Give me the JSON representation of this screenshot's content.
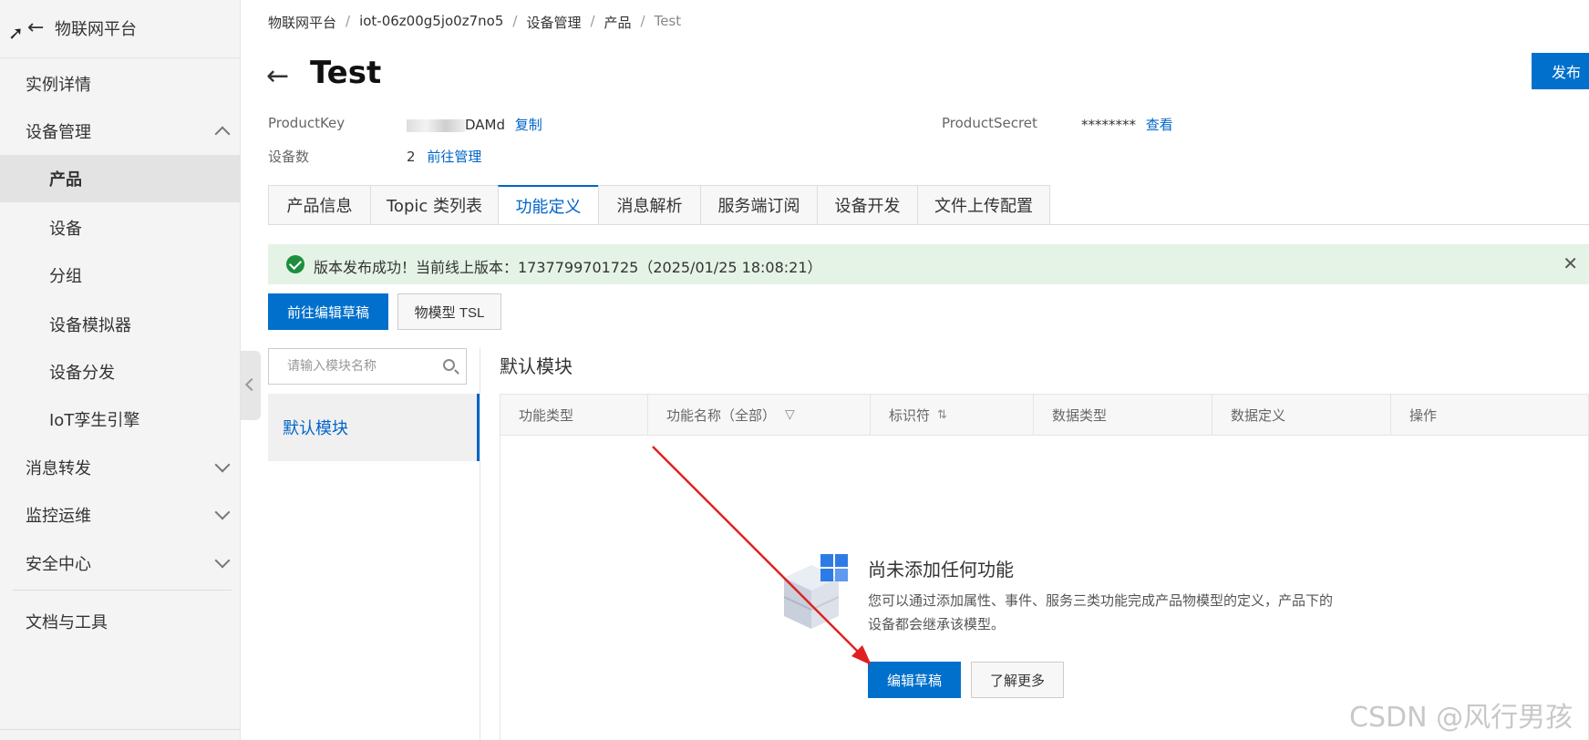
{
  "sidebar": {
    "back_icon": "arrow-left-icon",
    "title": "物联网平台",
    "items": [
      {
        "label": "实例详情"
      },
      {
        "label": "设备管理"
      },
      {
        "label": "产品"
      },
      {
        "label": "设备"
      },
      {
        "label": "分组"
      },
      {
        "label": "设备模拟器"
      },
      {
        "label": "设备分发"
      },
      {
        "label": "IoT孪生引擎"
      },
      {
        "label": "消息转发"
      },
      {
        "label": "监控运维"
      },
      {
        "label": "安全中心"
      },
      {
        "label": "文档与工具"
      }
    ]
  },
  "breadcrumb": [
    "物联网平台",
    "iot-06z00g5jo0z7no5",
    "设备管理",
    "产品",
    "Test"
  ],
  "header": {
    "title": "Test",
    "publish_label": "发布"
  },
  "info": {
    "product_key_label": "ProductKey",
    "product_key_value": "DAMd",
    "copy_label": "复制",
    "product_secret_label": "ProductSecret",
    "product_secret_value": "********",
    "view_label": "查看",
    "device_count_label": "设备数",
    "device_count_value": "2",
    "manage_label": "前往管理"
  },
  "tabs": [
    {
      "label": "产品信息"
    },
    {
      "label": "Topic 类列表"
    },
    {
      "label": "功能定义"
    },
    {
      "label": "消息解析"
    },
    {
      "label": "服务端订阅"
    },
    {
      "label": "设备开发"
    },
    {
      "label": "文件上传配置"
    }
  ],
  "alert": {
    "message": "版本发布成功！当前线上版本：1737799701725（2025/01/25 18:08:21）"
  },
  "actions": {
    "edit_draft_label": "前往编辑草稿",
    "tsl_label": "物模型 TSL"
  },
  "modules": {
    "search_placeholder": "请输入模块名称",
    "items": [
      {
        "label": "默认模块"
      }
    ],
    "section_title": "默认模块"
  },
  "table": {
    "columns": [
      "功能类型",
      "功能名称（全部）",
      "标识符",
      "数据类型",
      "数据定义",
      "操作"
    ]
  },
  "empty": {
    "title": "尚未添加任何功能",
    "description": "您可以通过添加属性、事件、服务三类功能完成产品物模型的定义，产品下的设备都会继承该模型。",
    "edit_label": "编辑草稿",
    "learn_label": "了解更多"
  },
  "watermark": "CSDN @风行男孩",
  "colors": {
    "primary": "#0070cc",
    "link": "#0064c8",
    "success_bg": "#e4f3e5",
    "success": "#1e8e3e",
    "annotation_arrow": "#e02020"
  }
}
